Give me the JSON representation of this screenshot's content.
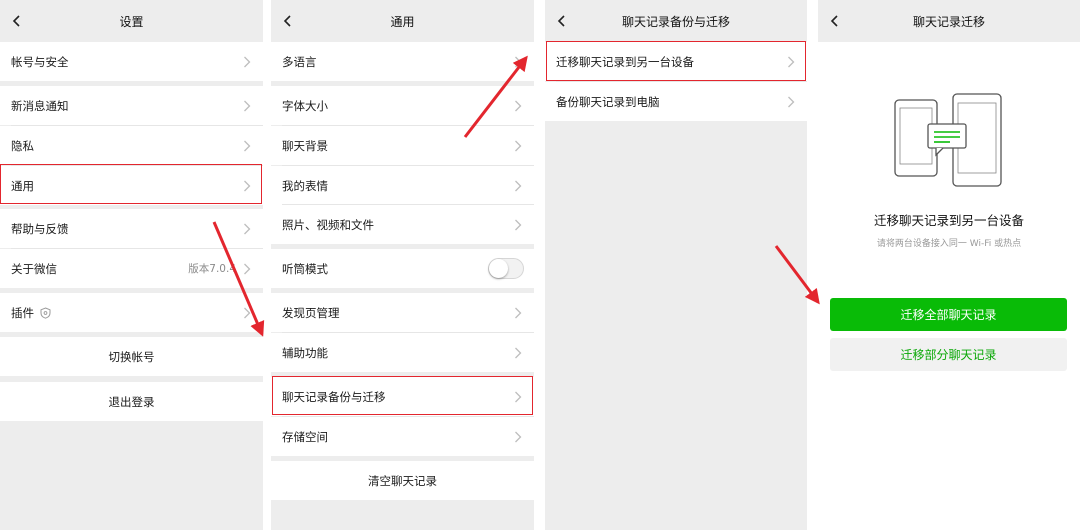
{
  "screen1": {
    "title": "设置",
    "items": [
      {
        "label": "帐号与安全"
      },
      {
        "label": "新消息通知"
      },
      {
        "label": "隐私"
      },
      {
        "label": "通用"
      },
      {
        "label": "帮助与反馈"
      },
      {
        "label": "关于微信",
        "value": "版本7.0.4"
      },
      {
        "label": "插件"
      }
    ],
    "switch_account": "切换帐号",
    "logout": "退出登录"
  },
  "screen2": {
    "title": "通用",
    "items": [
      {
        "label": "多语言"
      },
      {
        "label": "字体大小"
      },
      {
        "label": "聊天背景"
      },
      {
        "label": "我的表情"
      },
      {
        "label": "照片、视频和文件"
      },
      {
        "label": "听筒模式"
      },
      {
        "label": "发现页管理"
      },
      {
        "label": "辅助功能"
      },
      {
        "label": "聊天记录备份与迁移"
      },
      {
        "label": "存储空间"
      }
    ],
    "earpiece_mode_on": false,
    "clear_chat_history": "清空聊天记录"
  },
  "screen3": {
    "title": "聊天记录备份与迁移",
    "items": [
      {
        "label": "迁移聊天记录到另一台设备"
      },
      {
        "label": "备份聊天记录到电脑"
      }
    ]
  },
  "screen4": {
    "title": "聊天记录迁移",
    "heading": "迁移聊天记录到另一台设备",
    "hint": "请将两台设备接入同一 Wi-Fi 或热点",
    "primary_button": "迁移全部聊天记录",
    "secondary_button": "迁移部分聊天记录"
  },
  "colors": {
    "highlight": "#e3262e",
    "accent_green": "#09bb07",
    "background": "#ededed"
  },
  "icons": {
    "back": "chevron-left-icon",
    "disclosure": "chevron-right-icon",
    "plugin": "shield-icon",
    "migration_illustration": "phones-migration-icon"
  }
}
